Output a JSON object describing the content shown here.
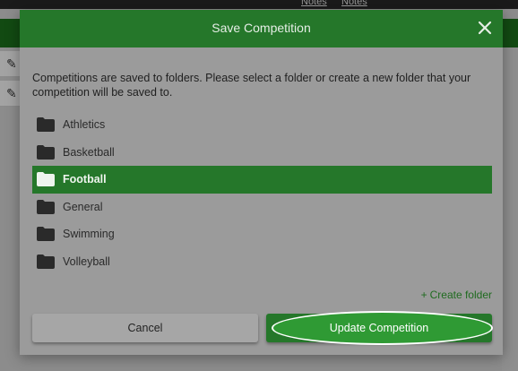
{
  "background": {
    "notes_links": [
      "Notes",
      "Notes"
    ]
  },
  "modal": {
    "title": "Save Competition",
    "close_icon": "close-icon",
    "instructions": "Competitions are saved to folders. Please select a folder or create a new folder that your competition will be saved to.",
    "folders": [
      {
        "label": "Athletics",
        "selected": false
      },
      {
        "label": "Basketball",
        "selected": false
      },
      {
        "label": "Football",
        "selected": true
      },
      {
        "label": "General",
        "selected": false
      },
      {
        "label": "Swimming",
        "selected": false
      },
      {
        "label": "Volleyball",
        "selected": false
      }
    ],
    "create_folder_plus": "+",
    "create_folder_label": "Create folder",
    "cancel_label": "Cancel",
    "update_label": "Update Competition"
  },
  "colors": {
    "header_green": "#25772a",
    "selected_green": "#25772a",
    "highlight_green": "#2f9a34",
    "link_green": "#1f6b1f"
  }
}
